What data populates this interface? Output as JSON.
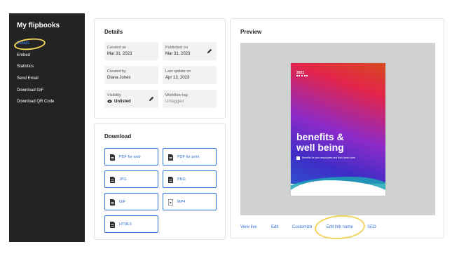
{
  "sidebar": {
    "title": "My flipbooks",
    "items": [
      {
        "label": "Details"
      },
      {
        "label": "Embed"
      },
      {
        "label": "Statistics"
      },
      {
        "label": "Send Email"
      },
      {
        "label": "Download GIF"
      },
      {
        "label": "Download QR Code"
      }
    ]
  },
  "details": {
    "title": "Details",
    "fields": [
      {
        "label": "Created on",
        "value": "Mar 31, 2023"
      },
      {
        "label": "Published on",
        "value": "Mar 31, 2023"
      },
      {
        "label": "Created by",
        "value": "Diana Jones"
      },
      {
        "label": "Last update on",
        "value": "Apr 13, 2023"
      },
      {
        "label": "Visibility",
        "value": "Unlisted"
      },
      {
        "label": "Workflow tag",
        "value": "Untagged"
      }
    ]
  },
  "download": {
    "title": "Download",
    "buttons": [
      {
        "label": "PDF for web"
      },
      {
        "label": "PDF for print"
      },
      {
        "label": "JPG"
      },
      {
        "label": "PNG"
      },
      {
        "label": "GIF"
      },
      {
        "label": "MP4"
      },
      {
        "label": "HTML5"
      }
    ]
  },
  "preview": {
    "title": "Preview",
    "book": {
      "year": "2021",
      "title_line1": "benefits &",
      "title_line2": "well being",
      "subtitle": "Benefits for your employees and their loved ones"
    },
    "links": [
      {
        "label": "View live"
      },
      {
        "label": "Edit"
      },
      {
        "label": "Customize"
      },
      {
        "label": "Edit link name"
      },
      {
        "label": "SEO"
      }
    ]
  },
  "colors": {
    "accent": "#2f6fd1",
    "sidebar_bg": "#232323",
    "highlight": "#f2d35b"
  }
}
